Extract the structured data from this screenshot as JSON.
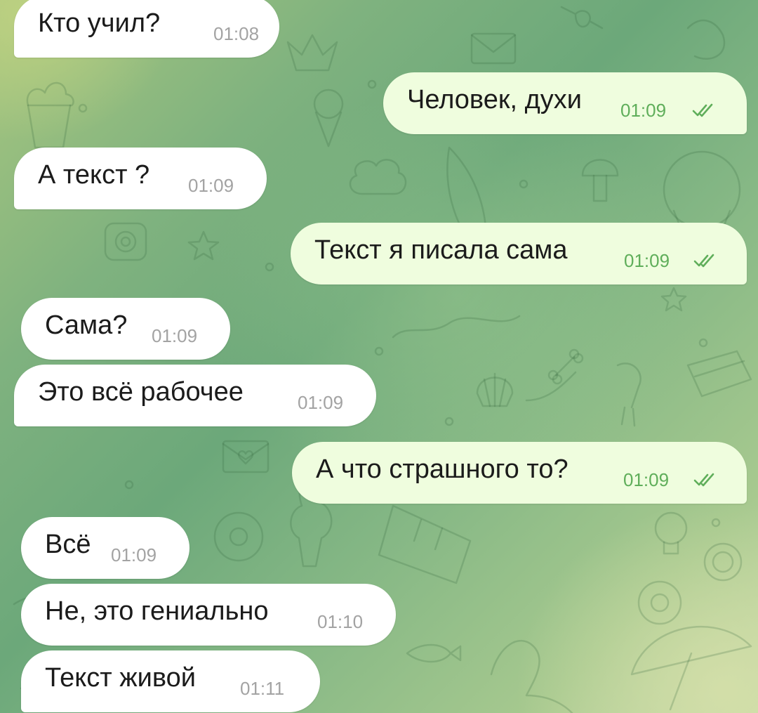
{
  "messages": [
    {
      "side": "in",
      "text": "Кто учил?",
      "time": "01:08"
    },
    {
      "side": "out",
      "text": "Человек, духи",
      "time": "01:09",
      "checks": "read-double-check-icon"
    },
    {
      "side": "in",
      "text": "А текст ?",
      "time": "01:09"
    },
    {
      "side": "out",
      "text": "Текст я писала сама",
      "time": "01:09",
      "checks": "read-double-check-icon"
    },
    {
      "side": "in",
      "text": "Сама?",
      "time": "01:09"
    },
    {
      "side": "in",
      "text": "Это всё рабочее",
      "time": "01:09"
    },
    {
      "side": "out",
      "text": "А что страшного то?",
      "time": "01:09",
      "checks": "read-double-check-icon"
    },
    {
      "side": "in",
      "text": "Всё",
      "time": "01:09"
    },
    {
      "side": "in",
      "text": "Не, это гениально",
      "time": "01:10"
    },
    {
      "side": "in",
      "text": "Текст живой",
      "time": "01:11"
    }
  ],
  "colors": {
    "incoming_bubble": "#ffffff",
    "outgoing_bubble": "#effdde",
    "outgoing_meta": "#5fae5a",
    "incoming_meta": "#a3a3a3",
    "text": "#1b1b1b"
  }
}
